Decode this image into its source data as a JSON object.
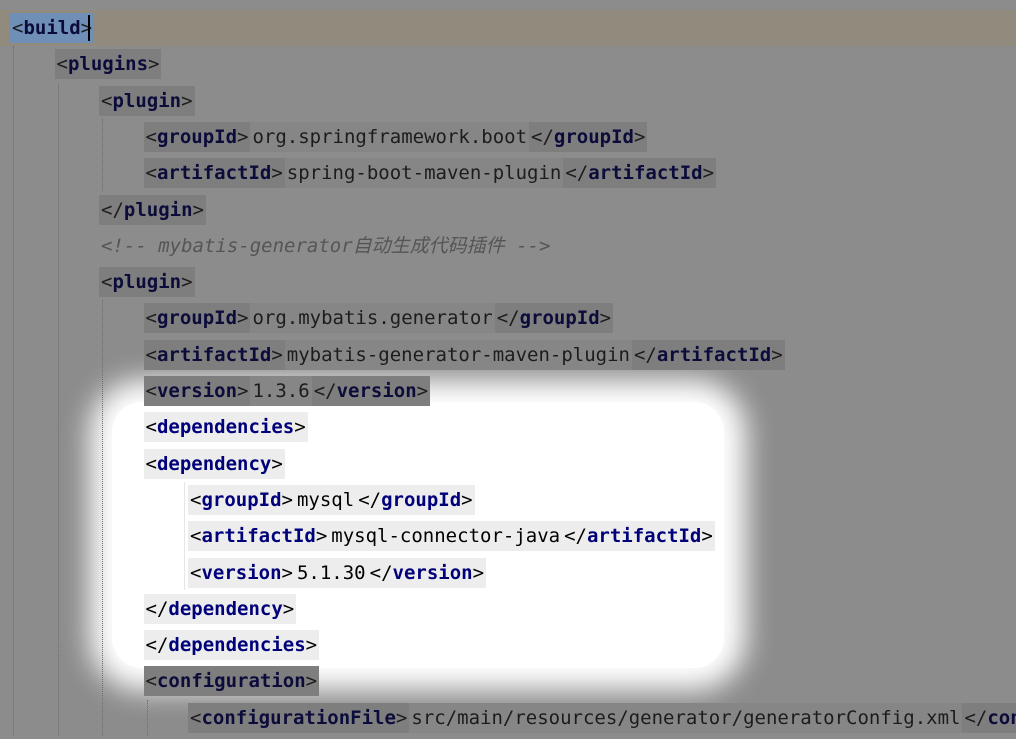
{
  "editor": {
    "lines": [
      {
        "indent": 0,
        "kind": "open",
        "tag": "build"
      },
      {
        "indent": 1,
        "kind": "open",
        "tag": "plugins"
      },
      {
        "indent": 2,
        "kind": "open",
        "tag": "plugin"
      },
      {
        "indent": 3,
        "kind": "elem",
        "tag": "groupId",
        "text": "org.springframework.boot"
      },
      {
        "indent": 3,
        "kind": "elem",
        "tag": "artifactId",
        "text": "spring-boot-maven-plugin"
      },
      {
        "indent": 2,
        "kind": "close",
        "tag": "plugin"
      },
      {
        "indent": 2,
        "kind": "comment",
        "text": "<!-- mybatis-generator自动生成代码插件 -->"
      },
      {
        "indent": 2,
        "kind": "open",
        "tag": "plugin"
      },
      {
        "indent": 3,
        "kind": "elem",
        "tag": "groupId",
        "text": "org.mybatis.generator"
      },
      {
        "indent": 3,
        "kind": "elem",
        "tag": "artifactId",
        "text": "mybatis-generator-maven-plugin"
      },
      {
        "indent": 3,
        "kind": "elem",
        "tag": "version",
        "text": "1.3.6"
      },
      {
        "indent": 3,
        "kind": "open",
        "tag": "dependencies"
      },
      {
        "indent": 3,
        "kind": "open",
        "tag": "dependency"
      },
      {
        "indent": 4,
        "kind": "elem",
        "tag": "groupId",
        "text": "mysql"
      },
      {
        "indent": 4,
        "kind": "elem",
        "tag": "artifactId",
        "text": "mysql-connector-java"
      },
      {
        "indent": 4,
        "kind": "elem",
        "tag": "version",
        "text": "5.1.30"
      },
      {
        "indent": 3,
        "kind": "close",
        "tag": "dependency"
      },
      {
        "indent": 3,
        "kind": "close",
        "tag": "dependencies"
      },
      {
        "indent": 3,
        "kind": "open",
        "tag": "configuration"
      },
      {
        "indent": 4,
        "kind": "elem",
        "tag": "configurationFile",
        "text": "src/main/resources/generator/generatorConfig.xml",
        "close_tag": "configu"
      }
    ],
    "highlighted_lines": [
      11,
      12,
      13,
      14,
      15,
      16,
      17
    ],
    "colors": {
      "background": "#8c8c8c",
      "highlight": "#ffffff",
      "tag": "#00007a",
      "selection": "#6f8fb7"
    }
  }
}
